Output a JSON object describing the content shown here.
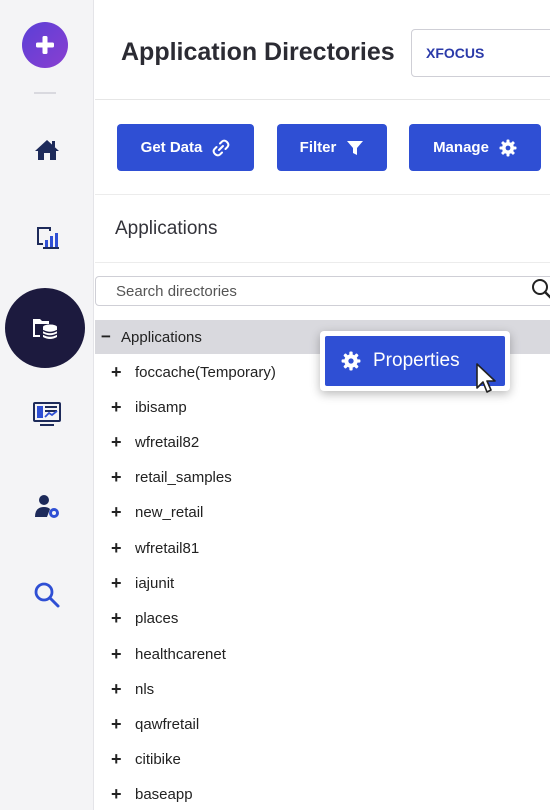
{
  "rail": {
    "items": [
      {
        "name": "add",
        "icon": "plus-icon"
      },
      {
        "name": "home",
        "icon": "home-icon"
      },
      {
        "name": "reports",
        "icon": "report-chart-icon"
      },
      {
        "name": "directories",
        "icon": "database-folder-icon",
        "active": true
      },
      {
        "name": "monitor",
        "icon": "monitor-dashboard-icon"
      },
      {
        "name": "users",
        "icon": "user-gear-icon"
      },
      {
        "name": "search",
        "icon": "search-icon"
      }
    ]
  },
  "header": {
    "title": "Application Directories",
    "server_select": "XFOCUS"
  },
  "toolbar": {
    "get_data_label": "Get Data",
    "filter_label": "Filter",
    "manage_label": "Manage"
  },
  "section": {
    "title": "Applications"
  },
  "search": {
    "placeholder": "Search directories"
  },
  "tree": {
    "root_label": "Applications",
    "items": [
      "foccache(Temporary)",
      "ibisamp",
      "wfretail82",
      "retail_samples",
      "new_retail",
      "wfretail81",
      "iajunit",
      "places",
      "healthcarenet",
      "nls",
      "qawfretail",
      "citibike",
      "baseapp"
    ]
  },
  "context_menu": {
    "properties_label": "Properties"
  },
  "colors": {
    "accent": "#2f4fd4",
    "rail_active": "#1c1a3e",
    "add_gradient_start": "#5b3fd6",
    "add_gradient_end": "#8a3fd1",
    "selected_row": "#d9d9de"
  }
}
